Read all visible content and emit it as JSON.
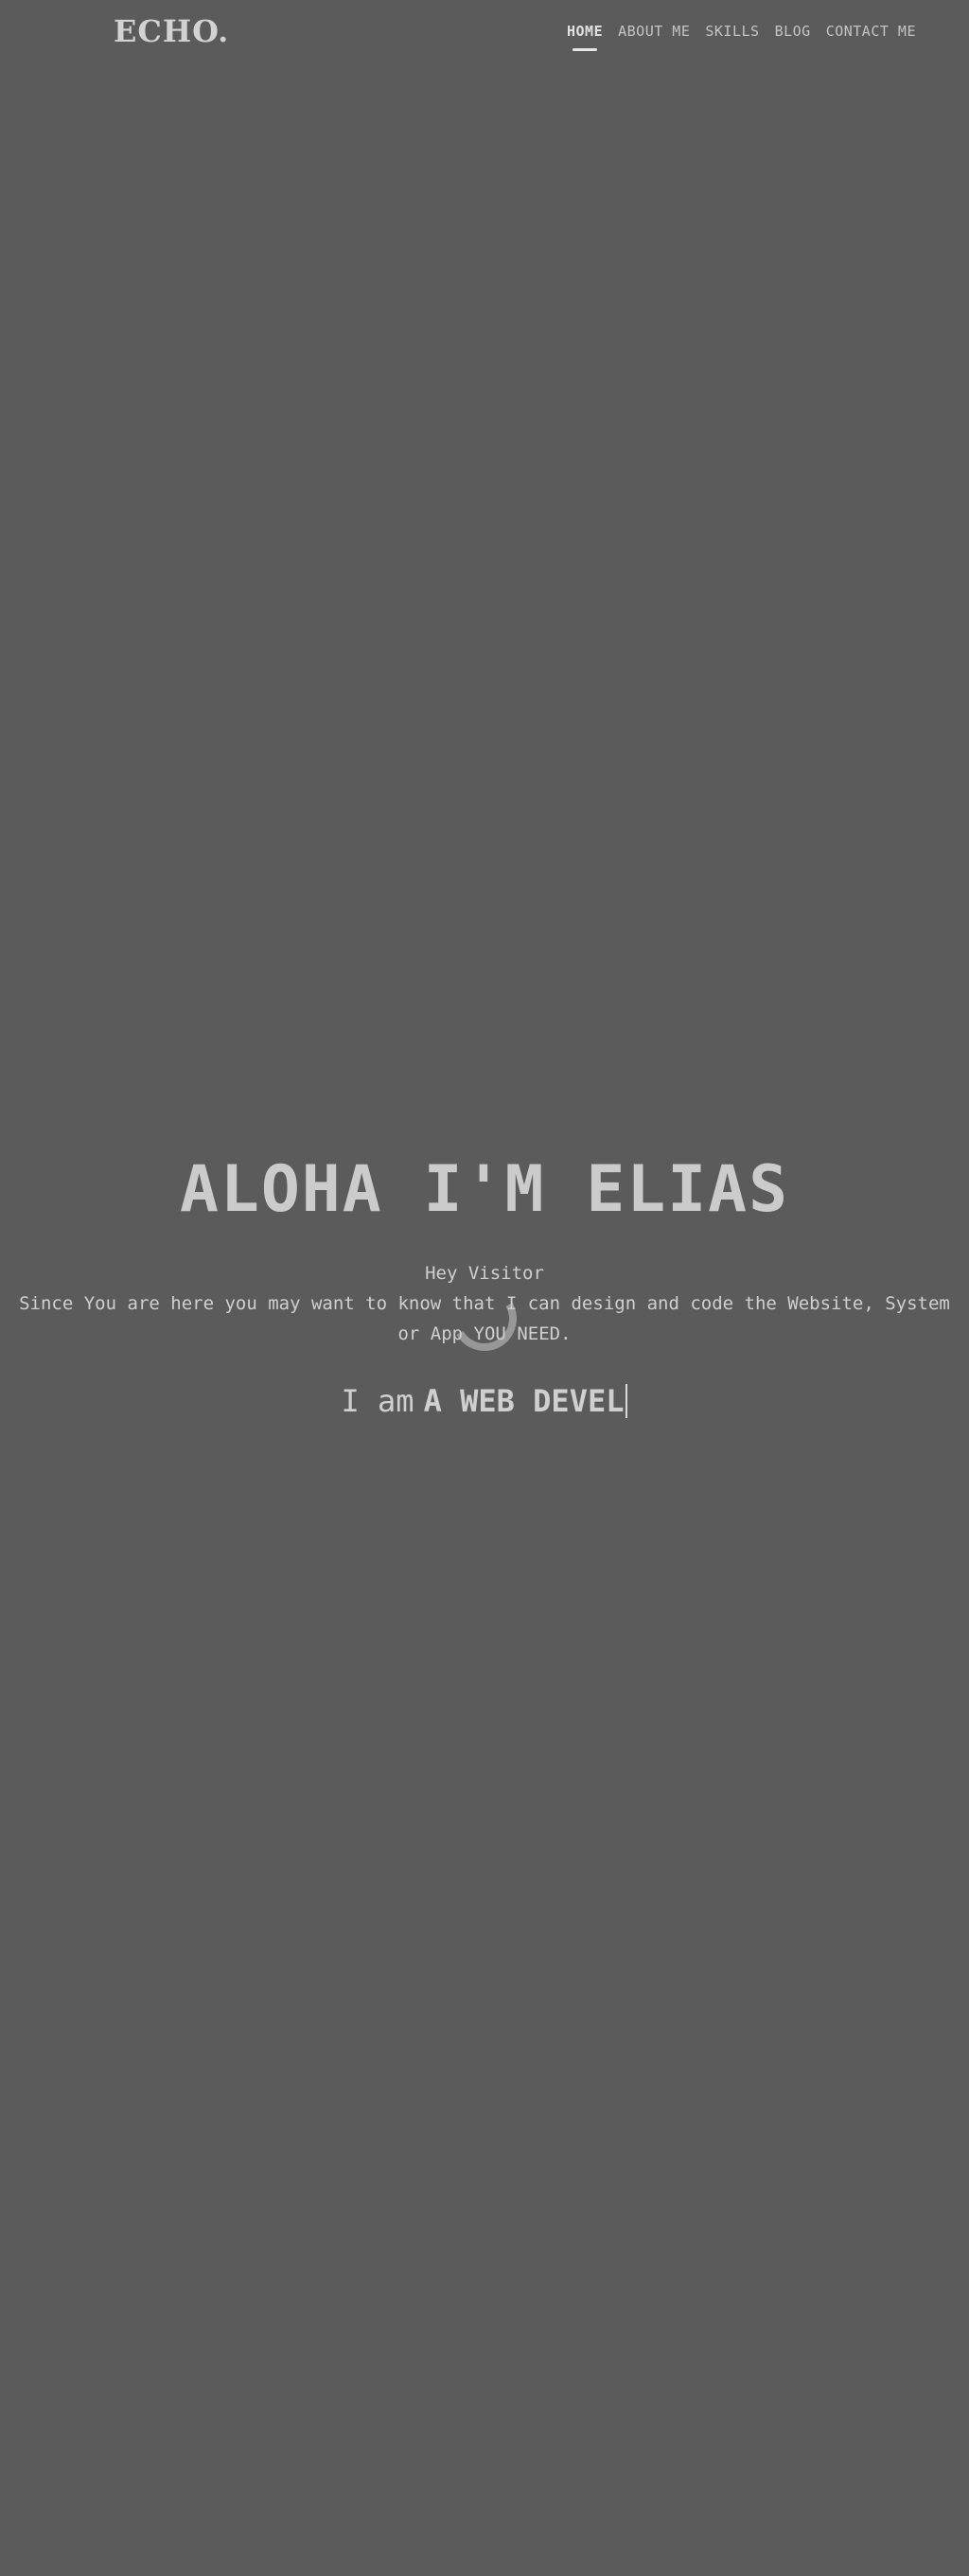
{
  "header": {
    "logo": "ECHO.",
    "nav": [
      {
        "label": "HOME",
        "active": true
      },
      {
        "label": "ABOUT ME",
        "active": false
      },
      {
        "label": "SKILLS",
        "active": false
      },
      {
        "label": "BLOG",
        "active": false
      },
      {
        "label": "CONTACT ME",
        "active": false
      }
    ]
  },
  "hero": {
    "title": "ALOHA I'M ELIAS",
    "greeting": "Hey Visitor",
    "text": "Since You are here you may want to know that I can design and code the Website, System or App YOU NEED.",
    "typing_prefix": "I am",
    "typing_word": "A WEB DEVEL"
  },
  "colors": {
    "background": "#5b5b5b",
    "text": "#cfcfcf"
  }
}
